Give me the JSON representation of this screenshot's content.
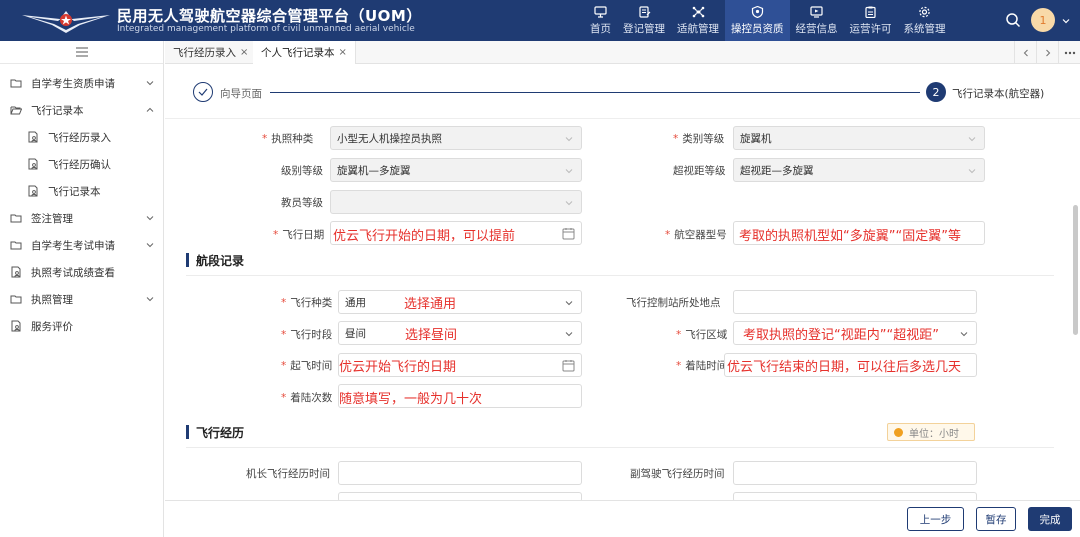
{
  "header": {
    "title": "民用无人驾驶航空器综合管理平台（UOM）",
    "subtitle": "Integrated management platform of civil unmanned aerial vehicle",
    "nav": [
      {
        "label": "首页",
        "icon": "monitor-icon"
      },
      {
        "label": "登记管理",
        "icon": "register-icon"
      },
      {
        "label": "适航管理",
        "icon": "drone-icon"
      },
      {
        "label": "操控员资质",
        "icon": "shield-icon",
        "active": true
      },
      {
        "label": "经营信息",
        "icon": "display-icon"
      },
      {
        "label": "运营许可",
        "icon": "clipboard-icon"
      },
      {
        "label": "系统管理",
        "icon": "settings-icon"
      }
    ],
    "avatar_text": "1"
  },
  "sidebar": {
    "items": [
      {
        "label": "自学考生资质申请",
        "icon": "folder-icon",
        "expandable": true
      },
      {
        "label": "飞行记录本",
        "icon": "folder-open-icon",
        "expandable": true
      },
      {
        "label": "飞行经历录入",
        "icon": "doc-user-icon"
      },
      {
        "label": "飞行经历确认",
        "icon": "doc-user-icon"
      },
      {
        "label": "飞行记录本",
        "icon": "doc-user-icon"
      },
      {
        "label": "签注管理",
        "icon": "folder-icon",
        "expandable": true
      },
      {
        "label": "自学考生考试申请",
        "icon": "folder-icon",
        "expandable": true
      },
      {
        "label": "执照考试成绩查看",
        "icon": "doc-user-icon"
      },
      {
        "label": "执照管理",
        "icon": "folder-icon",
        "expandable": true
      },
      {
        "label": "服务评价",
        "icon": "doc-user-icon"
      }
    ]
  },
  "tabs": [
    {
      "label": "飞行经历录入",
      "close": "×"
    },
    {
      "label": "个人飞行记录本",
      "close": "×"
    }
  ],
  "steps": {
    "step1": "向导页面",
    "step2_num": "2",
    "step2": "飞行记录本(航空器)"
  },
  "form": {
    "license_type_label": "执照种类",
    "license_type_value": "小型无人机操控员执照",
    "category_label": "类别等级",
    "category_value": "旋翼机",
    "level_label": "级别等级",
    "level_value": "旋翼机—多旋翼",
    "bvlos_label": "超视距等级",
    "bvlos_value": "超视距—多旋翼",
    "instructor_label": "教员等级",
    "flight_date_label": "飞行日期",
    "aircraft_model_label": "航空器型号"
  },
  "segment": {
    "title": "航段记录",
    "flight_type_label": "飞行种类",
    "flight_type_value": "通用",
    "control_station_label": "飞行控制站所处地点",
    "period_label": "飞行时段",
    "period_value": "昼间",
    "area_label": "飞行区域",
    "takeoff_label": "起飞时间",
    "landing_label": "着陆时间",
    "landings_label": "着陆次数"
  },
  "experience": {
    "title": "飞行经历",
    "unit": "单位：小时",
    "captain_label": "机长飞行经历时间",
    "copilot_label": "副驾驶飞行经历时间"
  },
  "annotations": {
    "flight_date": "优云飞行开始的日期，可以提前",
    "aircraft_model": "考取的执照机型如“多旋翼”“固定翼”等",
    "flight_type": "选择通用",
    "period": "选择昼间",
    "area": "考取执照的登记“视距内”“超视距”",
    "takeoff": "优云开始飞行的日期",
    "landing": "优云飞行结束的日期，可以往后多选几天",
    "landings": "随意填写，一般为几十次"
  },
  "footer": {
    "prev": "上一步",
    "save": "暂存",
    "finish": "完成"
  },
  "required_mark": "*"
}
